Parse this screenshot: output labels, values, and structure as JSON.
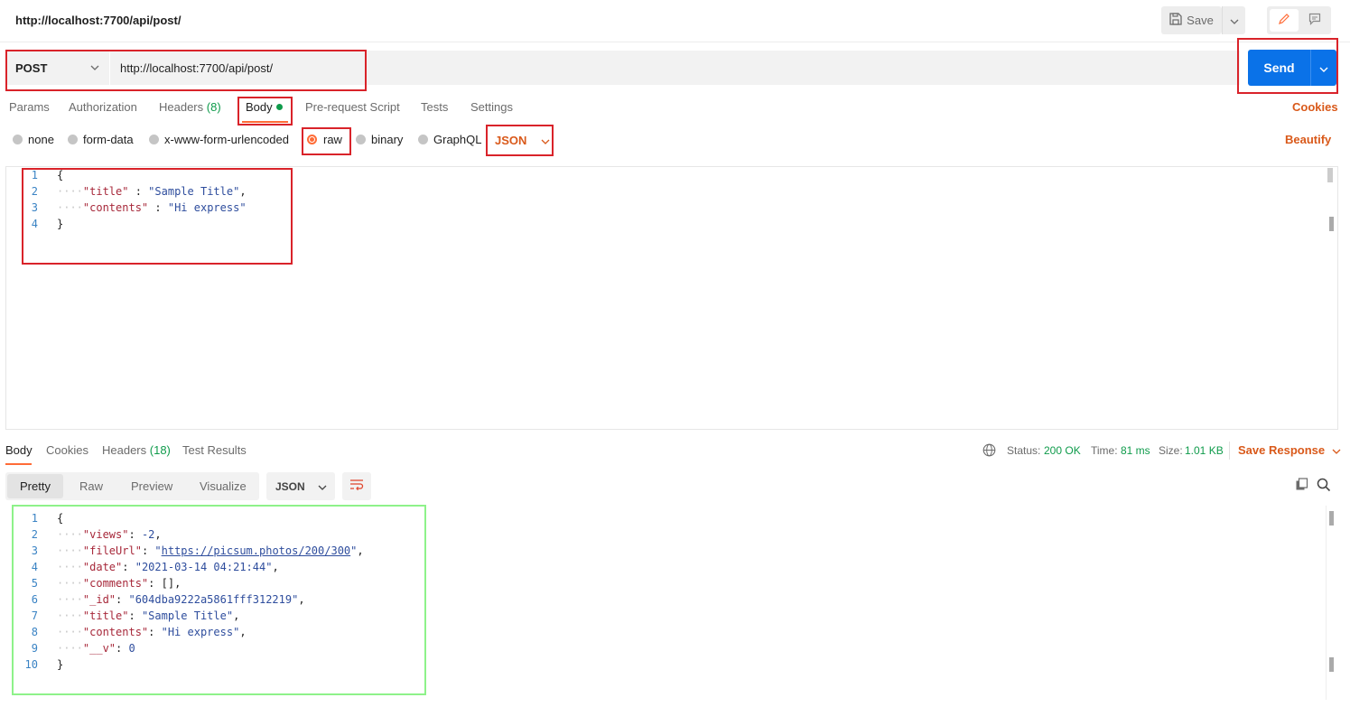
{
  "header": {
    "title": "http://localhost:7700/api/post/",
    "save_label": "Save"
  },
  "request": {
    "method": "POST",
    "url": "http://localhost:7700/api/post/",
    "send_label": "Send"
  },
  "request_tabs": {
    "params": "Params",
    "authorization": "Authorization",
    "headers": "Headers",
    "headers_count": "(8)",
    "body": "Body",
    "prerequest": "Pre-request Script",
    "tests": "Tests",
    "settings": "Settings",
    "cookies": "Cookies"
  },
  "body_types": {
    "none": "none",
    "form_data": "form-data",
    "urlencoded": "x-www-form-urlencoded",
    "raw": "raw",
    "binary": "binary",
    "graphql": "GraphQL",
    "selected": "raw",
    "format": "JSON",
    "beautify": "Beautify"
  },
  "request_body": {
    "line_numbers": [
      "1",
      "2",
      "3",
      "4"
    ],
    "open_brace": "{",
    "close_brace": "}",
    "title_key": "\"title\"",
    "title_sep": " : ",
    "title_value": "\"Sample Title\"",
    "contents_key": "\"contents\"",
    "contents_sep": " : ",
    "contents_value": "\"Hi express\""
  },
  "response_tabs": {
    "body": "Body",
    "cookies": "Cookies",
    "headers": "Headers",
    "headers_count": "(18)",
    "test_results": "Test Results"
  },
  "response_status": {
    "status_label": "Status:",
    "status_value": "200 OK",
    "time_label": "Time:",
    "time_value": "81 ms",
    "size_label": "Size:",
    "size_value": "1.01 KB",
    "save_response": "Save Response"
  },
  "response_view": {
    "pretty": "Pretty",
    "raw": "Raw",
    "preview": "Preview",
    "visualize": "Visualize",
    "format": "JSON"
  },
  "response_body": {
    "line_numbers": [
      "1",
      "2",
      "3",
      "4",
      "5",
      "6",
      "7",
      "8",
      "9",
      "10"
    ],
    "open_brace": "{",
    "close_brace": "}",
    "views_key": "\"views\"",
    "views_value": "-2",
    "fileurl_key": "\"fileUrl\"",
    "fileurl_value": "https://picsum.photos/200/300",
    "date_key": "\"date\"",
    "date_value": "\"2021-03-14 04:21:44\"",
    "comments_key": "\"comments\"",
    "comments_value": "[]",
    "id_key": "\"_id\"",
    "id_value": "\"604dba9222a5861fff312219\"",
    "title_key": "\"title\"",
    "title_value": "\"Sample Title\"",
    "contents_key": "\"contents\"",
    "contents_value": "\"Hi express\"",
    "v_key": "\"__v\"",
    "v_value": "0"
  },
  "colors": {
    "accent": "#ff6c37",
    "send_button": "#0a72e8",
    "success": "#0f9b4b",
    "highlight_box": "#d9232a",
    "response_box": "#8ef28a"
  },
  "icons": [
    "save-icon",
    "chevron-down-icon",
    "pencil-icon",
    "comment-icon",
    "globe-icon",
    "wrap-lines-icon",
    "copy-icon",
    "search-icon"
  ]
}
